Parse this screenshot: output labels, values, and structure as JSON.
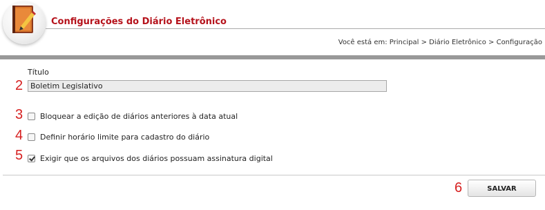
{
  "header": {
    "title": "Configurações do Diário Eletrônico",
    "breadcrumb": "Você está em: Principal > Diário Eletrônico > Configuração",
    "logo_icon": "book-pencil-icon"
  },
  "form": {
    "title_label": "Título",
    "title_value": "Boletim Legislativo",
    "options": [
      {
        "label": "Bloquear a edição de diários anteriores à data atual",
        "checked": false
      },
      {
        "label": "Definir horário limite para cadastro do diário",
        "checked": false
      },
      {
        "label": "Exigir que os arquivos dos diários possuam assinatura digital",
        "checked": true
      }
    ],
    "save_label": "SALVAR"
  },
  "annotations": [
    "2",
    "3",
    "4",
    "5",
    "6"
  ],
  "colors": {
    "title": "#b5121b",
    "annotation": "#d61f1f",
    "rule": "#999999"
  }
}
